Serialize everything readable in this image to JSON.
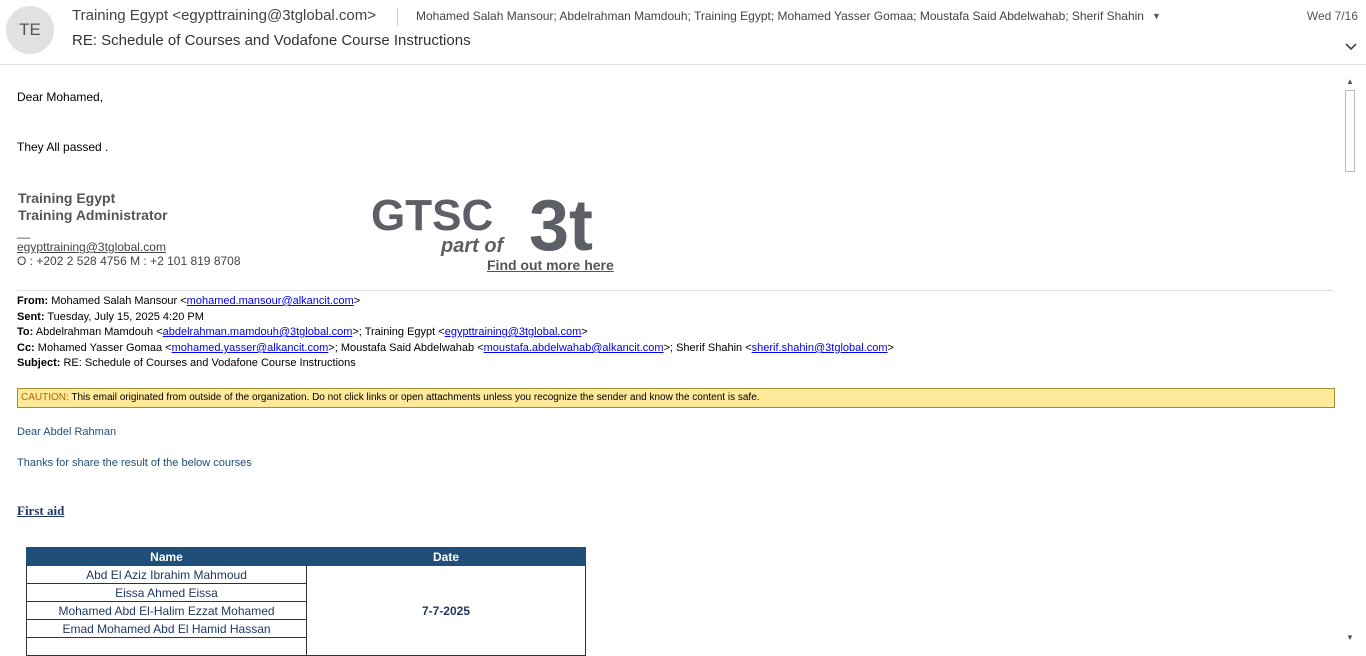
{
  "header": {
    "avatar_initials": "TE",
    "from": "Training Egypt <egypttraining@3tglobal.com>",
    "recipients": "Mohamed Salah Mansour; Abdelrahman Mamdouh; Training Egypt; Mohamed Yasser Gomaa; Moustafa Said Abdelwahab; Sherif Shahin",
    "date": "Wed 7/16",
    "subject": "RE: Schedule of Courses and Vodafone Course Instructions"
  },
  "body": {
    "greeting": "Dear Mohamed,",
    "message": "They All passed .",
    "signature": {
      "name": "Training Egypt",
      "title": "Training Administrator",
      "dash": "__",
      "email": "egypttraining@3tglobal.com",
      "phones": "O : +202 2 528 4756 M : +2 101 819 8708",
      "logo_main": "GTSC",
      "logo_sub": "part of",
      "logo_brand": "3t",
      "find_out": "Find out more here"
    },
    "quoted": {
      "from_label": "From:",
      "from_name": "Mohamed Salah Mansour <",
      "from_email": "mohamed.mansour@alkancit.com",
      "sent_label": "Sent:",
      "sent_value": "Tuesday, July 15, 2025 4:20 PM",
      "to_label": "To:",
      "to_1_name": "Abdelrahman Mamdouh <",
      "to_1_email": "abdelrahman.mamdouh@3tglobal.com",
      "to_2_name": ">; Training Egypt <",
      "to_2_email": "egypttraining@3tglobal.com",
      "cc_label": "Cc:",
      "cc_1_name": "Mohamed Yasser Gomaa <",
      "cc_1_email": "mohamed.yasser@alkancit.com",
      "cc_2_name": ">; Moustafa Said Abdelwahab <",
      "cc_2_email": "moustafa.abdelwahab@alkancit.com",
      "cc_3_name": ">; Sherif Shahin <",
      "cc_3_email": "sherif.shahin@3tglobal.com",
      "close": ">",
      "subject_label": "Subject:",
      "subject_value": "RE: Schedule of Courses and Vodafone Course Instructions"
    },
    "caution": {
      "label": "CAUTION:",
      "text": " This email originated from outside of the organization. Do not click links or open attachments unless you recognize the sender and know the content is safe."
    },
    "quoted_greeting": "Dear Abdel Rahman",
    "quoted_thanks": "Thanks for share the result of the below courses",
    "section_title": "First aid",
    "table": {
      "headers": [
        "Name",
        "Date"
      ],
      "names": [
        "Abd El Aziz Ibrahim Mahmoud",
        "Eissa Ahmed Eissa",
        "Mohamed Abd El-Halim Ezzat Mohamed",
        "Emad Mohamed Abd El Hamid Hassan"
      ],
      "date": "7-7-2025"
    }
  },
  "colors": {
    "table_header_bg": "#1f4e79",
    "caution_bg": "#fde99a",
    "link": "#0000ee"
  }
}
